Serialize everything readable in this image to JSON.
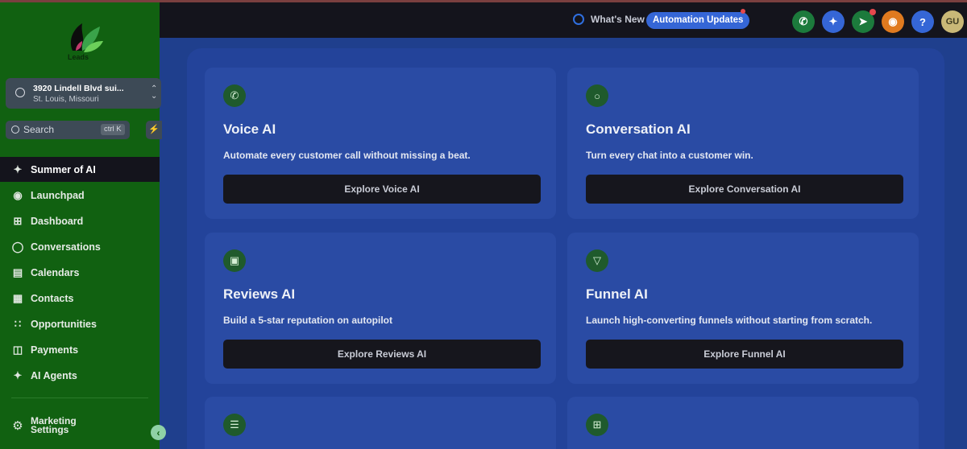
{
  "topbar": {
    "whats_new": "What's New",
    "automation_updates": "Automation Updates",
    "avatar_initials": "GU",
    "help_label": "?"
  },
  "sidebar": {
    "logo_text": "Leads",
    "location": {
      "name": "3920 Lindell Blvd sui...",
      "city": "St. Louis, Missouri"
    },
    "search": {
      "label": "Search",
      "shortcut": "ctrl K"
    },
    "items": [
      {
        "label": "Summer of AI",
        "icon": "sparkle-icon",
        "active": true
      },
      {
        "label": "Launchpad",
        "icon": "rocket-icon"
      },
      {
        "label": "Dashboard",
        "icon": "grid-icon"
      },
      {
        "label": "Conversations",
        "icon": "chat-bubble-icon"
      },
      {
        "label": "Calendars",
        "icon": "calendar-icon"
      },
      {
        "label": "Contacts",
        "icon": "contacts-book-icon"
      },
      {
        "label": "Opportunities",
        "icon": "network-icon"
      },
      {
        "label": "Payments",
        "icon": "receipt-icon"
      },
      {
        "label": "AI Agents",
        "icon": "sparkle-icon"
      }
    ],
    "bottom": {
      "label": "Marketing Settings"
    }
  },
  "cards": [
    {
      "title": "Voice AI",
      "desc": "Automate every customer call without missing a beat.",
      "button": "Explore Voice AI",
      "icon": "phone-icon"
    },
    {
      "title": "Conversation AI",
      "desc": "Turn every chat into a customer win.",
      "button": "Explore Conversation AI",
      "icon": "chat-bubble-icon"
    },
    {
      "title": "Reviews AI",
      "desc": "Build a 5-star reputation on autopilot",
      "button": "Explore Reviews AI",
      "icon": "review-message-icon"
    },
    {
      "title": "Funnel AI",
      "desc": "Launch high-converting funnels without starting from scratch.",
      "button": "Explore Funnel AI",
      "icon": "funnel-icon"
    }
  ],
  "colors": {
    "sidebar_bg": "#116111",
    "topbar_bg": "#14141c",
    "main_bg": "#1f3f8d",
    "card_bg": "#2a4ba4",
    "accent": "#3566d6"
  }
}
